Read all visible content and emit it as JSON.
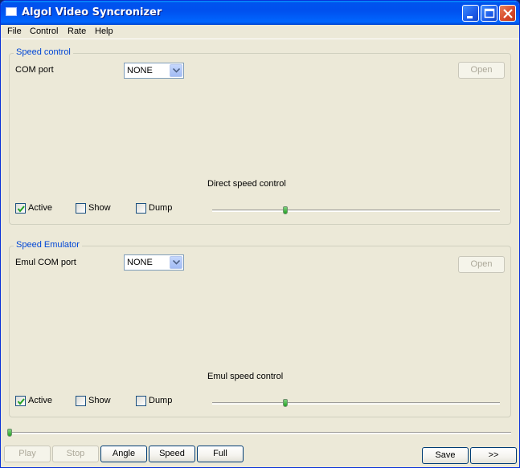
{
  "window": {
    "title": "Algol Video Syncronizer"
  },
  "menu": [
    "File",
    "Control",
    "Rate",
    "Help"
  ],
  "speed_control": {
    "title": "Speed control",
    "port_label": "COM port",
    "port_value": "NONE",
    "open_label": "Open",
    "slider_label": "Direct speed control",
    "slider_value": 0.25,
    "active_label": "Active",
    "active_checked": true,
    "show_label": "Show",
    "show_checked": false,
    "dump_label": "Dump",
    "dump_checked": false
  },
  "speed_emulator": {
    "title": "Speed Emulator",
    "port_label": "Emul COM port",
    "port_value": "NONE",
    "open_label": "Open",
    "slider_label": "Emul speed control",
    "slider_value": 0.25,
    "active_label": "Active",
    "active_checked": true,
    "show_label": "Show",
    "show_checked": false,
    "dump_label": "Dump",
    "dump_checked": false
  },
  "position_slider_value": 0.0,
  "bottom_buttons": {
    "play": "Play",
    "stop": "Stop",
    "angle": "Angle",
    "speed": "Speed",
    "full": "Full",
    "save": "Save",
    "more": ">>"
  },
  "colors": {
    "titlebar": "#0053ee",
    "group_title": "#0046d5",
    "window_bg": "#ece9d8"
  }
}
